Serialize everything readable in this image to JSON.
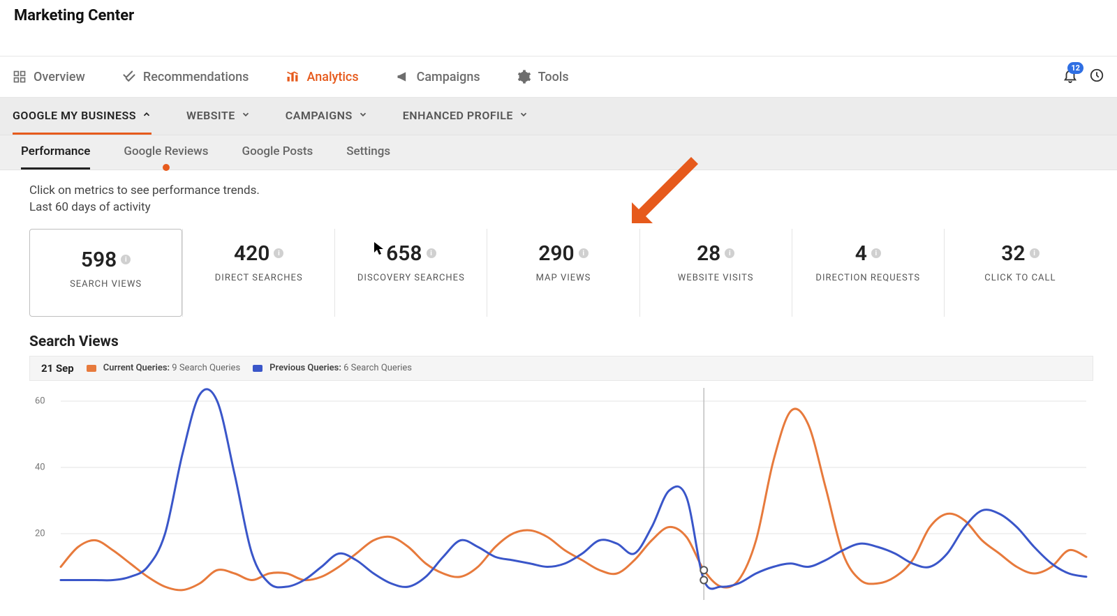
{
  "colors": {
    "accent": "#e65a1c",
    "blue": "#3a56c9",
    "orange_series": "#e77a3c",
    "badge": "#2f6fe3"
  },
  "page_title": "Marketing Center",
  "topnav": {
    "items": [
      {
        "label": "Overview",
        "icon": "grid-icon"
      },
      {
        "label": "Recommendations",
        "icon": "check-icon"
      },
      {
        "label": "Analytics",
        "icon": "bars-icon",
        "active": true
      },
      {
        "label": "Campaigns",
        "icon": "megaphone-icon"
      },
      {
        "label": "Tools",
        "icon": "gear-icon"
      }
    ],
    "notifications_badge": "12"
  },
  "subnav": {
    "items": [
      {
        "label": "GOOGLE MY BUSINESS",
        "active": true,
        "chev": "up"
      },
      {
        "label": "WEBSITE",
        "chev": "down"
      },
      {
        "label": "CAMPAIGNS",
        "chev": "down"
      },
      {
        "label": "ENHANCED PROFILE",
        "chev": "down"
      }
    ]
  },
  "tertnav": {
    "items": [
      {
        "label": "Performance",
        "active": true
      },
      {
        "label": "Google Reviews",
        "dot": true
      },
      {
        "label": "Google Posts"
      },
      {
        "label": "Settings"
      }
    ]
  },
  "hint_line1": "Click on metrics to see performance trends.",
  "hint_line2": "Last 60 days of activity",
  "metrics": [
    {
      "value": "598",
      "label": "SEARCH VIEWS",
      "selected": true
    },
    {
      "value": "420",
      "label": "DIRECT SEARCHES"
    },
    {
      "value": "658",
      "label": "DISCOVERY SEARCHES"
    },
    {
      "value": "290",
      "label": "MAP VIEWS"
    },
    {
      "value": "28",
      "label": "WEBSITE VISITS"
    },
    {
      "value": "4",
      "label": "DIRECTION REQUESTS"
    },
    {
      "value": "32",
      "label": "CLICK TO CALL"
    }
  ],
  "chart_title": "Search Views",
  "legend": {
    "date": "21 Sep",
    "current_label": "Current Queries:",
    "current_value": "9 Search Queries",
    "previous_label": "Previous Queries:",
    "previous_value": "6 Search Queries"
  },
  "chart_data": {
    "type": "line",
    "title": "Search Views",
    "xlabel": "",
    "ylabel": "",
    "ylim": [
      0,
      64
    ],
    "y_ticks": [
      20,
      40,
      60
    ],
    "hover_x_index": 37,
    "series": [
      {
        "name": "Current Queries",
        "color": "#e77a3c",
        "values": [
          10,
          16,
          18,
          15,
          11,
          7,
          4,
          3,
          5,
          9,
          8,
          6,
          8,
          8,
          6,
          7,
          10,
          14,
          18,
          19,
          16,
          11,
          8,
          7,
          10,
          16,
          20,
          21,
          19,
          15,
          12,
          9,
          8,
          12,
          18,
          22,
          19,
          9,
          4,
          6,
          18,
          42,
          57,
          53,
          34,
          14,
          6,
          5,
          7,
          12,
          22,
          26,
          24,
          18,
          14,
          10,
          8,
          10,
          15,
          13
        ]
      },
      {
        "name": "Previous Queries",
        "color": "#3a56c9",
        "values": [
          6,
          6,
          6,
          6,
          7,
          10,
          20,
          44,
          62,
          60,
          38,
          14,
          5,
          4,
          6,
          10,
          14,
          12,
          8,
          5,
          4,
          7,
          13,
          18,
          16,
          13,
          12,
          11,
          10,
          11,
          14,
          18,
          17,
          14,
          22,
          33,
          31,
          6,
          4,
          5,
          8,
          10,
          11,
          10,
          12,
          15,
          17,
          16,
          14,
          11,
          10,
          14,
          22,
          27,
          26,
          22,
          16,
          11,
          8,
          7
        ]
      }
    ]
  }
}
